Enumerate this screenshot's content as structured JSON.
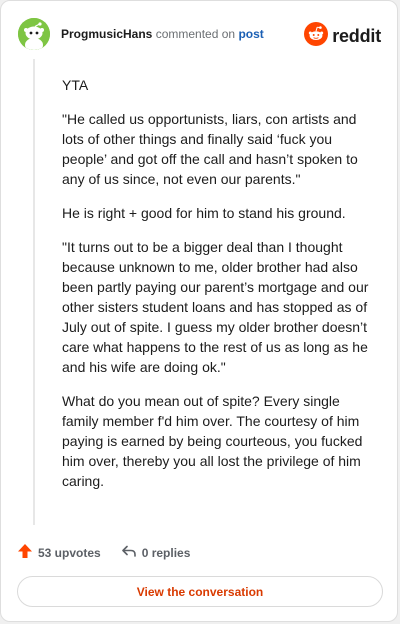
{
  "header": {
    "username": "ProgmusicHans",
    "action_text": "commented on",
    "post_link": "post",
    "brand": "reddit"
  },
  "comment": {
    "paragraphs": [
      "YTA",
      "\"He called us opportunists, liars, con artists and lots of other things and finally said ‘fuck you people’ and got off the call and hasn’t spoken to any of us since, not even our parents.\"",
      "He is right + good for him to stand his ground.",
      "\"It turns out to be a bigger deal than I thought because unknown to me, older brother had also been partly paying our parent’s mortgage and our other sisters student loans and has stopped as of July out of spite. I guess my older brother doesn’t care what happens to the rest of us as long as he and his wife are doing ok.\"",
      "What do you mean out of spite? Every single family member f'd him over. The courtesy of him paying is earned by being courteous, you fucked him over, thereby you all lost the privilege of him caring."
    ]
  },
  "actions": {
    "upvotes": "53 upvotes",
    "replies": "0 replies"
  },
  "cta": {
    "label": "View the conversation"
  },
  "colors": {
    "brand_orange": "#ff4500",
    "link_blue": "#1a5fb4",
    "cta_text": "#d93a00",
    "avatar_green": "#7ec543"
  },
  "icons": [
    "snoo-avatar-icon",
    "reddit-logo-icon",
    "upvote-arrow-icon",
    "reply-arrow-icon"
  ]
}
